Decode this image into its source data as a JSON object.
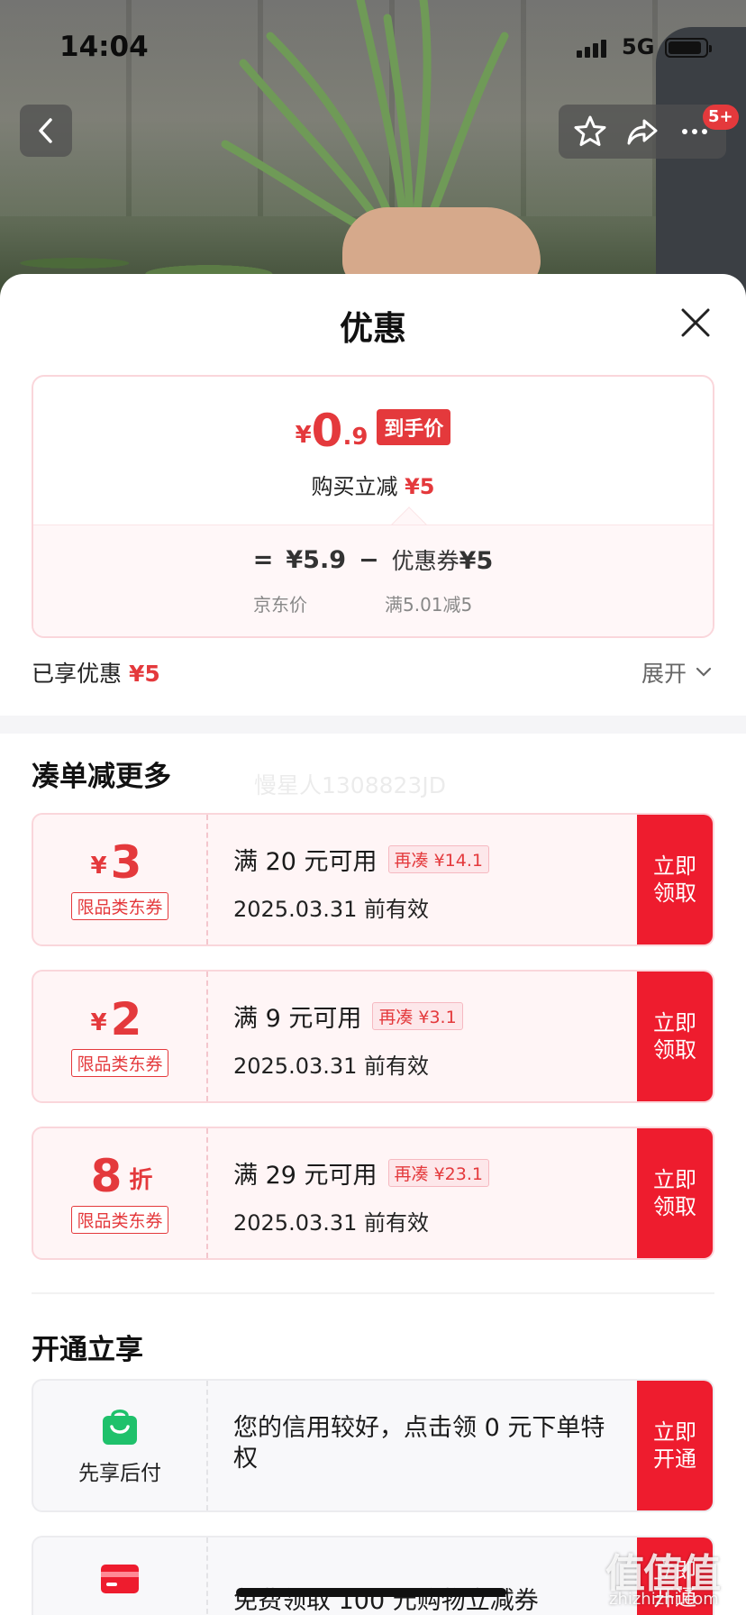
{
  "status_bar": {
    "time": "14:04",
    "network": "5G"
  },
  "nav": {
    "badge": "5+"
  },
  "sheet": {
    "title": "优惠"
  },
  "price": {
    "yen": "¥",
    "integer": "0",
    "decimal": ".9",
    "tag": "到手价",
    "direct_label": "购买立减",
    "direct_value": "¥5",
    "equals": "=",
    "jd_price": "¥5.9",
    "minus": "−",
    "coupon_label": "优惠券",
    "coupon_value": "¥5",
    "jd_price_label": "京东价",
    "coupon_rule": "满5.01减5"
  },
  "summary": {
    "label": "已享优惠",
    "value": "¥5",
    "expand": "展开"
  },
  "section_more": {
    "title": "凑单减更多",
    "watermark": "慢星人1308823JD"
  },
  "coupons": [
    {
      "yen": "¥",
      "amount": "3",
      "unit": "",
      "kind": "限品类东券",
      "condition": "满 20 元可用",
      "more": "再凑 ¥14.1",
      "validity": "2025.03.31 前有效",
      "action": "立即领取"
    },
    {
      "yen": "¥",
      "amount": "2",
      "unit": "",
      "kind": "限品类东券",
      "condition": "满 9 元可用",
      "more": "再凑 ¥3.1",
      "validity": "2025.03.31 前有效",
      "action": "立即领取"
    },
    {
      "yen": "",
      "amount": "8",
      "unit": "折",
      "kind": "限品类东券",
      "condition": "满 29 元可用",
      "more": "再凑 ¥23.1",
      "validity": "2025.03.31 前有效",
      "action": "立即领取"
    }
  ],
  "section_open": {
    "title": "开通立享"
  },
  "services": [
    {
      "icon": "shopping-bag-icon",
      "name": "先享后付",
      "description": "您的信用较好，点击领 0 元下单特权",
      "action": "立即开通"
    },
    {
      "icon": "card-icon",
      "name": "",
      "description": "免费领取 100 元购物立减券",
      "action": "立即开通"
    }
  ],
  "brand_watermark": {
    "text": "值值值",
    "url": "zhizhizhi.com"
  },
  "colors": {
    "accent": "#e4393c",
    "action_red": "#ee1c2e",
    "coupon_bg": "#fff5f6",
    "icon_green": "#1fc16b"
  }
}
